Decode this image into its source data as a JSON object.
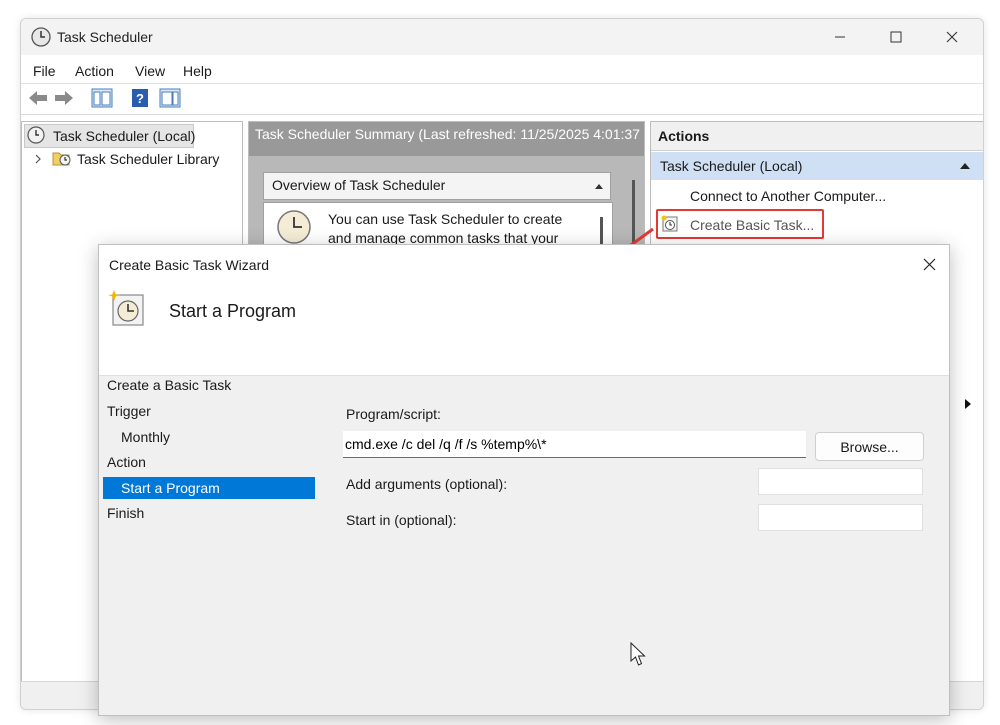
{
  "window": {
    "title": "Task Scheduler"
  },
  "menu": [
    "File",
    "Action",
    "View",
    "Help"
  ],
  "tree": {
    "root": "Task Scheduler (Local)",
    "library": "Task Scheduler Library"
  },
  "center": {
    "header": "Task Scheduler Summary (Last refreshed: 11/25/2025 4:01:37",
    "overview_title": "Overview of Task Scheduler",
    "overview_line1": "You can use Task Scheduler to create",
    "overview_line2": "and manage common tasks that your"
  },
  "actions": {
    "title": "Actions",
    "section": "Task Scheduler (Local)",
    "items": [
      "Connect to Another Computer...",
      "Create Basic Task..."
    ]
  },
  "dialog": {
    "title": "Create Basic Task Wizard",
    "heading": "Start a Program",
    "steps": [
      "Create a Basic Task",
      "Trigger",
      "Monthly",
      "Action",
      "Start a Program",
      "Finish"
    ],
    "program_label": "Program/script:",
    "program_value": "cmd.exe /c del /q /f /s %temp%\\*",
    "browse_label": "Browse...",
    "args_label": "Add arguments (optional):",
    "args_value": "",
    "startin_label": "Start in (optional):",
    "startin_value": ""
  },
  "colors": {
    "accent": "#0078d7",
    "highlight": "#e53935",
    "section_bg": "#cfe0f4"
  }
}
